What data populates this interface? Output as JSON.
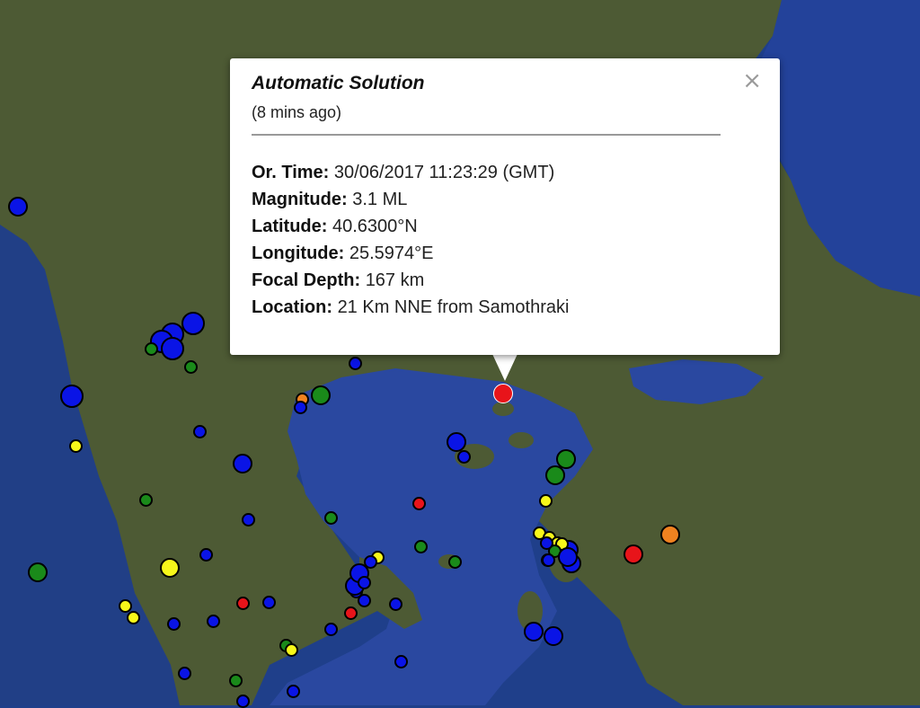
{
  "popup": {
    "title": "Automatic Solution",
    "subtitle": "(8 mins ago)",
    "close_icon": "×",
    "details": [
      {
        "label": "Or. Time:",
        "value": "30/06/2017  11:23:29 (GMT)"
      },
      {
        "label": "Magnitude:",
        "value": "3.1 ML"
      },
      {
        "label": "Latitude:",
        "value": "40.6300°N"
      },
      {
        "label": "Longitude:",
        "value": "25.5974°E"
      },
      {
        "label": "Focal Depth:",
        "value": "167 km"
      },
      {
        "label": "Location:",
        "value": "21 Km NNE from Samothraki"
      }
    ]
  },
  "colors": {
    "blue": "#0a14e6",
    "green": "#1a8a1a",
    "yellow": "#f7f71a",
    "red": "#e8141a",
    "orange": "#f08220",
    "sea": "#1f3f8a",
    "land": "#4d5a34"
  },
  "markers": [
    {
      "color": "blue",
      "size": "medium"
    },
    {
      "color": "blue",
      "size": "large"
    },
    {
      "color": "blue",
      "size": "large"
    },
    {
      "color": "blue",
      "size": "large"
    },
    {
      "color": "blue",
      "size": "large"
    },
    {
      "color": "green",
      "size": "small"
    },
    {
      "color": "green",
      "size": "small"
    },
    {
      "color": "blue",
      "size": "large"
    },
    {
      "color": "orange",
      "size": "small"
    },
    {
      "color": "green",
      "size": "medium"
    },
    {
      "color": "blue",
      "size": "small"
    },
    {
      "color": "blue",
      "size": "small"
    },
    {
      "color": "yellow",
      "size": "small"
    },
    {
      "color": "blue",
      "size": "small"
    },
    {
      "color": "blue",
      "size": "medium"
    },
    {
      "color": "green",
      "size": "small"
    },
    {
      "color": "blue",
      "size": "small"
    },
    {
      "color": "green",
      "size": "small"
    },
    {
      "color": "green",
      "size": "medium"
    },
    {
      "color": "blue",
      "size": "small"
    },
    {
      "color": "yellow",
      "size": "medium"
    },
    {
      "color": "yellow",
      "size": "small"
    },
    {
      "color": "yellow",
      "size": "small"
    },
    {
      "color": "blue",
      "size": "small"
    },
    {
      "color": "blue",
      "size": "small"
    },
    {
      "color": "red",
      "size": "small"
    },
    {
      "color": "blue",
      "size": "small"
    },
    {
      "color": "blue",
      "size": "small"
    },
    {
      "color": "blue",
      "size": "small"
    },
    {
      "color": "yellow",
      "size": "small"
    },
    {
      "color": "blue",
      "size": "small"
    },
    {
      "color": "red",
      "size": "small"
    },
    {
      "color": "blue",
      "size": "small"
    },
    {
      "color": "blue",
      "size": "small"
    },
    {
      "color": "green",
      "size": "small"
    },
    {
      "color": "yellow",
      "size": "small"
    },
    {
      "color": "blue",
      "size": "small"
    },
    {
      "color": "green",
      "size": "small"
    },
    {
      "color": "blue",
      "size": "small"
    },
    {
      "color": "blue",
      "size": "small"
    },
    {
      "color": "blue",
      "size": "small"
    },
    {
      "color": "blue",
      "size": "medium"
    },
    {
      "color": "blue",
      "size": "small"
    },
    {
      "color": "yellow",
      "size": "small"
    },
    {
      "color": "green",
      "size": "small"
    },
    {
      "color": "yellow",
      "size": "small"
    },
    {
      "color": "green",
      "size": "small"
    },
    {
      "color": "blue",
      "size": "small"
    },
    {
      "color": "blue",
      "size": "medium"
    },
    {
      "color": "red",
      "size": "small"
    },
    {
      "color": "blue",
      "size": "medium"
    },
    {
      "color": "green",
      "size": "medium"
    },
    {
      "color": "green",
      "size": "medium"
    },
    {
      "color": "yellow",
      "size": "small"
    },
    {
      "color": "yellow",
      "size": "small"
    },
    {
      "color": "yellow",
      "size": "small"
    },
    {
      "color": "green",
      "size": "small"
    },
    {
      "color": "blue",
      "size": "small"
    },
    {
      "color": "blue",
      "size": "medium"
    },
    {
      "color": "blue",
      "size": "medium"
    },
    {
      "color": "blue",
      "size": "medium"
    },
    {
      "color": "blue",
      "size": "small"
    },
    {
      "color": "red",
      "size": "medium"
    },
    {
      "color": "orange",
      "size": "medium"
    },
    {
      "color": "red",
      "size": "medium"
    },
    {
      "color": "blue",
      "size": "medium"
    },
    {
      "color": "blue",
      "size": "medium"
    },
    {
      "color": "blue",
      "size": "small"
    }
  ]
}
